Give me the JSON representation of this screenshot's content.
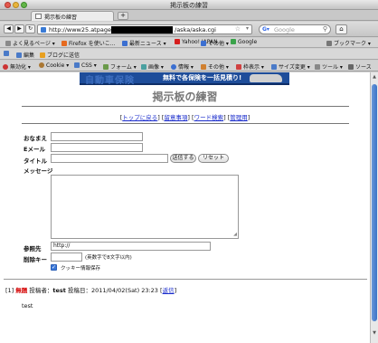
{
  "window": {
    "title": "掲示板の練習"
  },
  "tabs": [
    {
      "label": "掲示板の練習"
    }
  ],
  "nav": {
    "back": "◀",
    "forward": "▶",
    "url_start": "http://www25.atpages.jp/",
    "url_end": "/aska/aska.cgi",
    "search_placeholder": "Google",
    "home": "⌂"
  },
  "bookmarks": [
    {
      "label": "よく見るページ ▾",
      "color": "#8a8a8a"
    },
    {
      "label": "Firefox を使いこ...",
      "color": "#e66a1f"
    },
    {
      "label": "最新ニュース ▾",
      "color": "#3b6fd1"
    },
    {
      "label": "Yahoo! JAPAN",
      "color": "#d61e1e"
    },
    {
      "label": "その他 ▾",
      "color": "#3b6fd1"
    },
    {
      "label": "Google",
      "color": "#3aa34a"
    }
  ],
  "bookmarks_menu": "ブックマーク ▾",
  "toolbar2": [
    {
      "label": "編集",
      "color": "#4a7ac8"
    },
    {
      "label": "ブログに送信",
      "color": "#e8a020"
    }
  ],
  "toolbar3": [
    {
      "label": "無効化 ▾",
      "color": "#cc3333"
    },
    {
      "label": "Cookie ▾",
      "color": "#aa7733"
    },
    {
      "label": "CSS ▾",
      "color": "#4a7ac8"
    },
    {
      "label": "フォーム ▾",
      "color": "#6a9a4a"
    },
    {
      "label": "画像 ▾",
      "color": "#4aa0a0"
    },
    {
      "label": "情報 ▾",
      "color": "#3b6fd1"
    },
    {
      "label": "その他 ▾",
      "color": "#d08030"
    },
    {
      "label": "枠表示 ▾",
      "color": "#d04040"
    },
    {
      "label": "サイズ変更 ▾",
      "color": "#4a7ac8"
    },
    {
      "label": "ツール ▾",
      "color": "#888888"
    },
    {
      "label": "ソース",
      "color": "#666666"
    }
  ],
  "page": {
    "banner_big": "自動車保険",
    "banner_small": "無料で各保険を一括見積り!",
    "title": "掲示板の練習",
    "links": [
      {
        "label": "トップに戻る"
      },
      {
        "label": "留意事項"
      },
      {
        "label": "ワード検索"
      },
      {
        "label": "管理用"
      }
    ],
    "form": {
      "name_label": "おなまえ",
      "email_label": "Eメール",
      "title_label": "タイトル",
      "submit": "送信する",
      "reset": "リセット",
      "message_label": "メッセージ",
      "url_label": "参照先",
      "url_value": "http://",
      "delkey_label": "削除キー",
      "delkey_note": "(英数字で8文字以内)",
      "cookie_label": "クッキー情報保存"
    },
    "post": {
      "number": "[1]",
      "title": "無題",
      "poster_label": "投稿者：",
      "poster": "test",
      "date_label": "投稿日：",
      "date": "2011/04/02(Sat) 23:23",
      "reply": "返信",
      "body": "test"
    }
  }
}
